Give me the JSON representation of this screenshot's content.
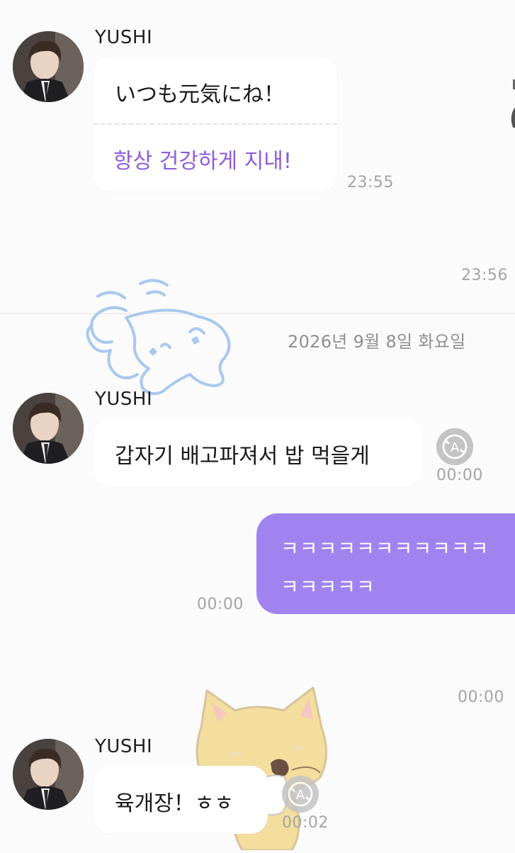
{
  "messages": {
    "m1": {
      "sender": "YUSHI",
      "original": "いつも元気にね！",
      "translation": "항상 건강하게 지내!",
      "time": "23:55"
    },
    "m2": {
      "time": "23:56"
    },
    "date_separator": "2026년 9월 8일 화요일",
    "m3": {
      "sender": "YUSHI",
      "text": "갑자기 배고파져서 밥 먹을게",
      "time": "00:00",
      "translate_icon": "A"
    },
    "m4": {
      "line1": "ㅋㅋㅋㅋㅋㅋㅋㅋㅋㅋㅋ",
      "line2": "ㅋㅋㅋㅋㅋ",
      "time": "00:00"
    },
    "m5": {
      "time": "00:00"
    },
    "m6": {
      "sender": "YUSHI",
      "text": "육개장！ㅎㅎ",
      "time": "00:02",
      "translate_icon": "A"
    }
  },
  "colors": {
    "background": "#fbfbfb",
    "outgoing_bubble": "#a183f0",
    "translation_text": "#8d5be0",
    "timestamp": "#a4a4a4"
  },
  "icons": [
    "avatar-photo",
    "translate-icon",
    "sticker-bird",
    "sticker-cat"
  ]
}
